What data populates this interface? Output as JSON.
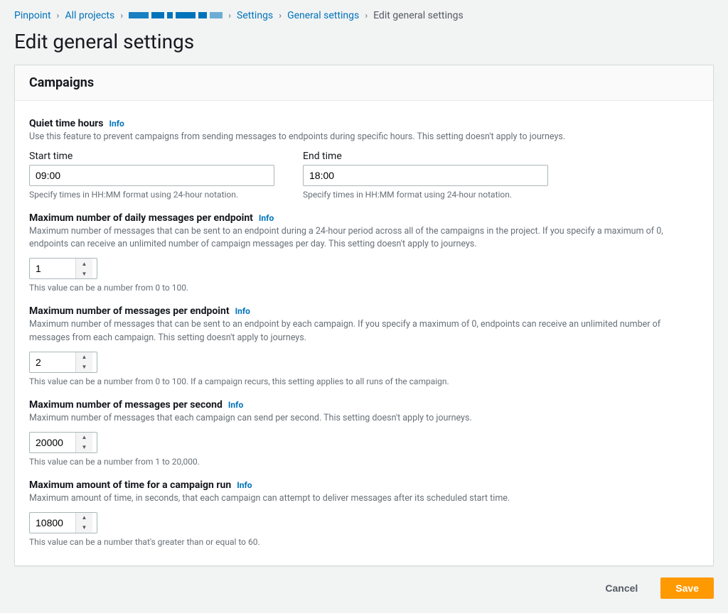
{
  "breadcrumb": {
    "items": [
      "Pinpoint",
      "All projects",
      "",
      "Settings",
      "General settings"
    ],
    "current": "Edit general settings"
  },
  "page_title": "Edit general settings",
  "panel_title": "Campaigns",
  "info_label": "Info",
  "quiet_time": {
    "title": "Quiet time hours",
    "desc": "Use this feature to prevent campaigns from sending messages to endpoints during specific hours. This setting doesn't apply to journeys.",
    "start_label": "Start time",
    "start_value": "09:00",
    "end_label": "End time",
    "end_value": "18:00",
    "hint": "Specify times in HH:MM format using 24-hour notation."
  },
  "daily_max": {
    "title": "Maximum number of daily messages per endpoint",
    "desc": "Maximum number of messages that can be sent to an endpoint during a 24-hour period across all of the campaigns in the project. If you specify a maximum of 0, endpoints can receive an unlimited number of campaign messages per day. This setting doesn't apply to journeys.",
    "value": "1",
    "hint": "This value can be a number from 0 to 100."
  },
  "per_endpoint": {
    "title": "Maximum number of messages per endpoint",
    "desc": "Maximum number of messages that can be sent to an endpoint by each campaign. If you specify a maximum of 0, endpoints can receive an unlimited number of messages from each campaign. This setting doesn't apply to journeys.",
    "value": "2",
    "hint": "This value can be a number from 0 to 100. If a campaign recurs, this setting applies to all runs of the campaign."
  },
  "per_second": {
    "title": "Maximum number of messages per second",
    "desc": "Maximum number of messages that each campaign can send per second. This setting doesn't apply to journeys.",
    "value": "20000",
    "hint": "This value can be a number from 1 to 20,000."
  },
  "run_time": {
    "title": "Maximum amount of time for a campaign run",
    "desc": "Maximum amount of time, in seconds, that each campaign can attempt to deliver messages after its scheduled start time.",
    "value": "10800",
    "hint": "This value can be a number that's greater than or equal to 60."
  },
  "actions": {
    "cancel": "Cancel",
    "save": "Save"
  }
}
